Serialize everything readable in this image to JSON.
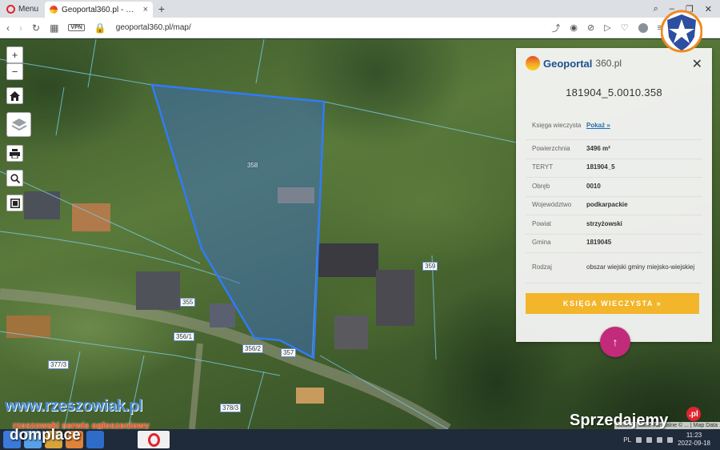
{
  "browser": {
    "menu_label": "Menu",
    "tab_title": "Geoportal360.pl - Mapa In",
    "tab_close": "×",
    "new_tab": "+",
    "url": "geoportal360.pl/map/",
    "vpn": "VPN"
  },
  "map": {
    "zoom_in": "+",
    "zoom_out": "−",
    "parcel_labels": [
      "358",
      "359",
      "355",
      "356/1",
      "356/2",
      "357",
      "377/3",
      "378/3"
    ],
    "attribution": "Leaflet | Dane Kastralne © ... | Map Data"
  },
  "panel": {
    "brand_name": "Geoportal",
    "brand_suffix": "360.pl",
    "close": "✕",
    "parcel_id": "181904_5.0010.358",
    "rows": [
      {
        "key": "Księga wieczysta",
        "value": "Pokaż »",
        "link": true
      },
      {
        "key": "Powierzchnia",
        "value": "3496 m²"
      },
      {
        "key": "TERYT",
        "value": "181904_5"
      },
      {
        "key": "Obręb",
        "value": "0010"
      },
      {
        "key": "Województwo",
        "value": "podkarpackie"
      },
      {
        "key": "Powiat",
        "value": "strzyżowski"
      },
      {
        "key": "Gmina",
        "value": "1819045"
      },
      {
        "key": "Rodzaj",
        "value": "obszar wiejski gminy miejsko-wiejskiej"
      }
    ],
    "kw_button": "KSIĘGA WIECZYSTA »",
    "scroll_top": "↑"
  },
  "watermarks": {
    "rzeszowiak": "www.rzeszowiak.pl",
    "rzeszowiak_sub": "rzeszowski serwis ogłoszeniowy",
    "domplace": "domplace",
    "sprzedajemy": "Sprzedajemy",
    "sprzedajemy_pl": ".pl"
  },
  "taskbar": {
    "lang": "PL",
    "time": "11:23",
    "date": "2022-09-18"
  },
  "colors": {
    "parcel_outline": "#2f7cf6",
    "parcel_fill": "#3a6fd0",
    "button_yellow": "#f3b52a",
    "scroll_magenta": "#c22b7a"
  }
}
